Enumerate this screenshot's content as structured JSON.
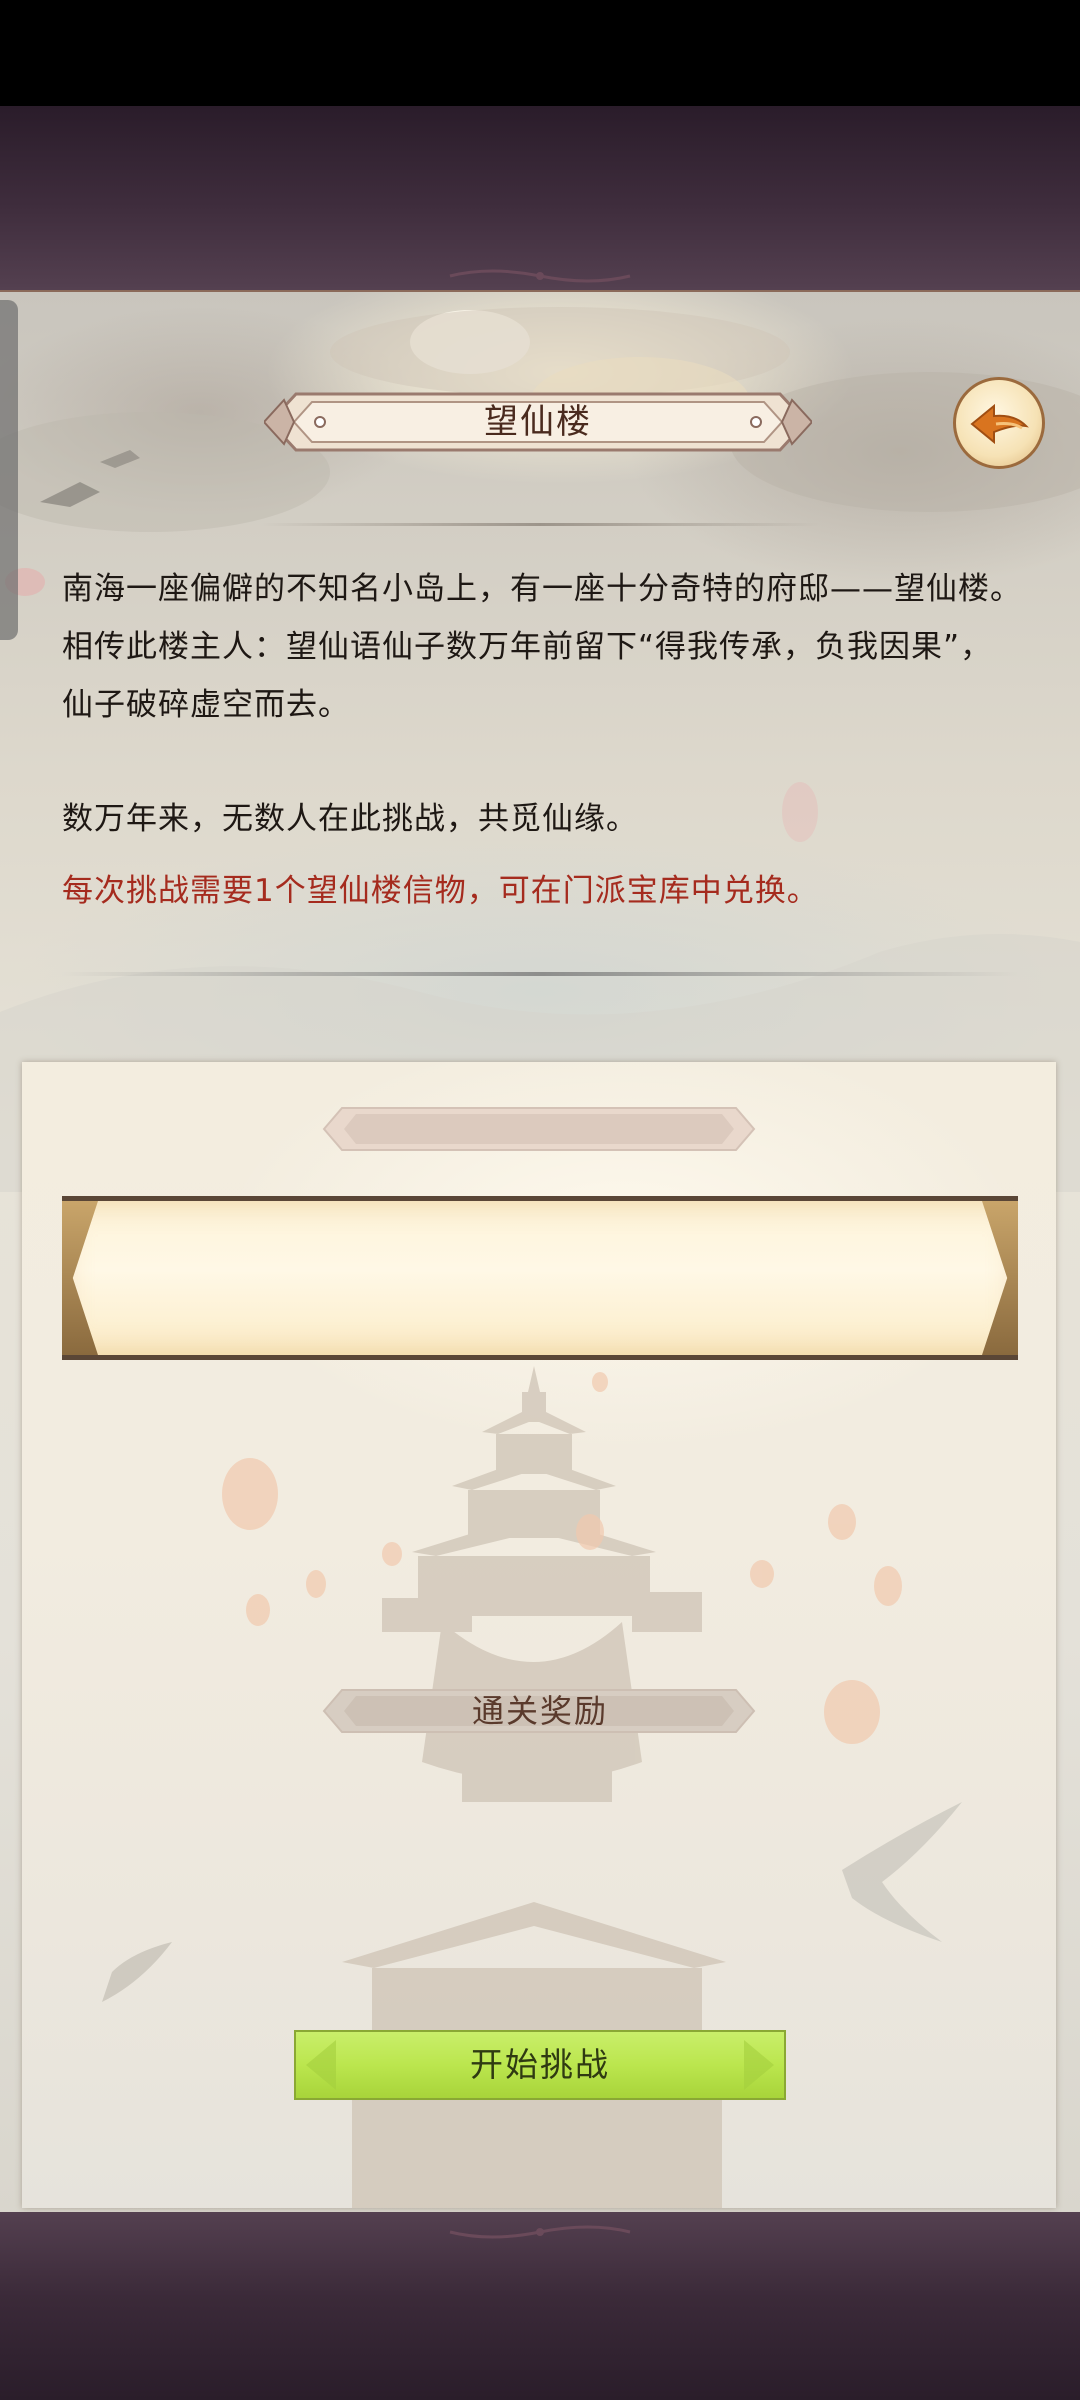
{
  "header": {
    "title": "望仙楼"
  },
  "description": {
    "paragraph_1": "南海一座偏僻的不知名小岛上，有一座十分奇特的府邸——望仙楼。相传此楼主人：望仙语仙子数万年前留下“得我传承，负我因果”，仙子破碎虚空而去。",
    "paragraph_2": "数万年来，无数人在此挑战，共觅仙缘。",
    "notice": "每次挑战需要1个望仙楼信物，可在门派宝库中兑换。"
  },
  "challenge": {
    "reward_label": "通关奖励",
    "start_button_label": "开始挑战"
  },
  "icons": {
    "back": "back-arrow-icon"
  },
  "colors": {
    "notice_text": "#a52b1e",
    "start_button": "#bbe64e",
    "title_text": "#4a2a1e"
  }
}
